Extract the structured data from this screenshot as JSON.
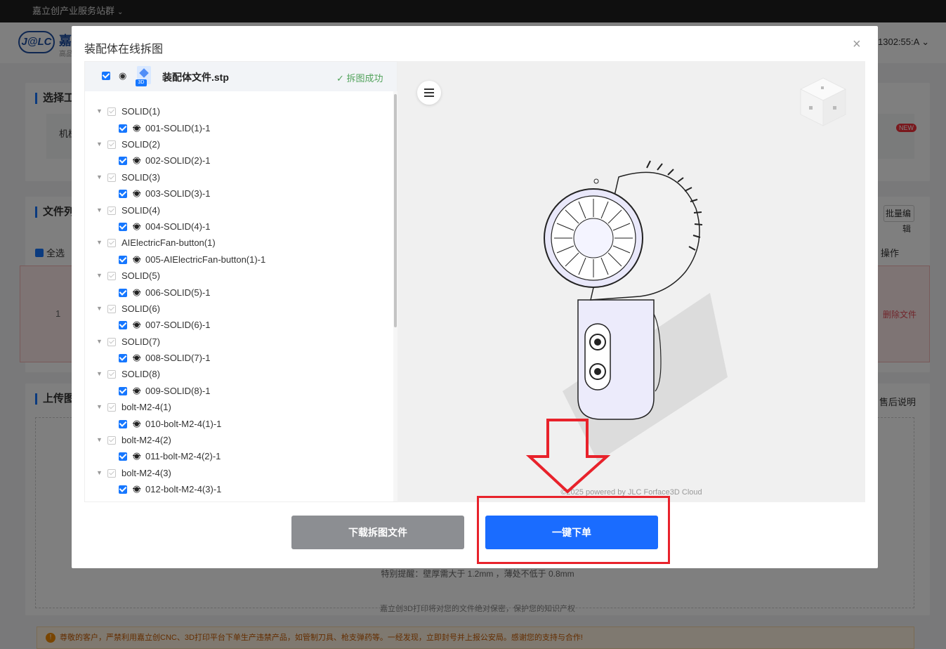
{
  "background": {
    "topbar": {
      "label": "嘉立创产业服务站群"
    },
    "header": {
      "logo": "J@LC",
      "brand": "嘉",
      "brand_sub": "高品",
      "user": "1302:55:A"
    },
    "section_process": {
      "title": "选择工",
      "option": "机械",
      "new_badge": "NEW"
    },
    "section_files": {
      "title": "文件列",
      "batch_edit": "批量编辑",
      "select_all": "全选",
      "op_col": "操作",
      "row_index": "1",
      "delete_file": "删除文件"
    },
    "section_upload": {
      "title": "上传图",
      "after_sale": "售后说明",
      "tip_wall": "特别提醒：壁厚需大于 1.2mm ，薄处不低于 0.8mm",
      "tip_privacy": "嘉立创3D打印将对您的文件绝对保密，保护您的知识产权"
    },
    "warning": "尊敬的客户，严禁利用嘉立创CNC、3D打印平台下单生产违禁产品，如管制刀具、枪支弹药等。一经发现，立即封号并上报公安局。感谢您的支持与合作!"
  },
  "modal": {
    "title": "装配体在线拆图",
    "close_symbol": "×",
    "tree": {
      "file_name": "装配体文件.stp",
      "file_badge": "3D",
      "status": "✓ 拆图成功",
      "nodes": [
        {
          "label": "SOLID(1)",
          "child": "001-SOLID(1)-1"
        },
        {
          "label": "SOLID(2)",
          "child": "002-SOLID(2)-1"
        },
        {
          "label": "SOLID(3)",
          "child": "003-SOLID(3)-1"
        },
        {
          "label": "SOLID(4)",
          "child": "004-SOLID(4)-1"
        },
        {
          "label": "AIElectricFan-button(1)",
          "child": "005-AIElectricFan-button(1)-1"
        },
        {
          "label": "SOLID(5)",
          "child": "006-SOLID(5)-1"
        },
        {
          "label": "SOLID(6)",
          "child": "007-SOLID(6)-1"
        },
        {
          "label": "SOLID(7)",
          "child": "008-SOLID(7)-1"
        },
        {
          "label": "SOLID(8)",
          "child": "009-SOLID(8)-1"
        },
        {
          "label": "bolt-M2-4(1)",
          "child": "010-bolt-M2-4(1)-1"
        },
        {
          "label": "bolt-M2-4(2)",
          "child": "011-bolt-M2-4(2)-1"
        },
        {
          "label": "bolt-M2-4(3)",
          "child": "012-bolt-M2-4(3)-1"
        }
      ]
    },
    "viewer": {
      "watermark": "©2025 powered by JLC Forface3D Cloud"
    },
    "buttons": {
      "download": "下载拆图文件",
      "order": "一键下单"
    }
  },
  "colors": {
    "primary": "#1a6cff",
    "success": "#53a35c",
    "annotation": "#e8222b"
  }
}
